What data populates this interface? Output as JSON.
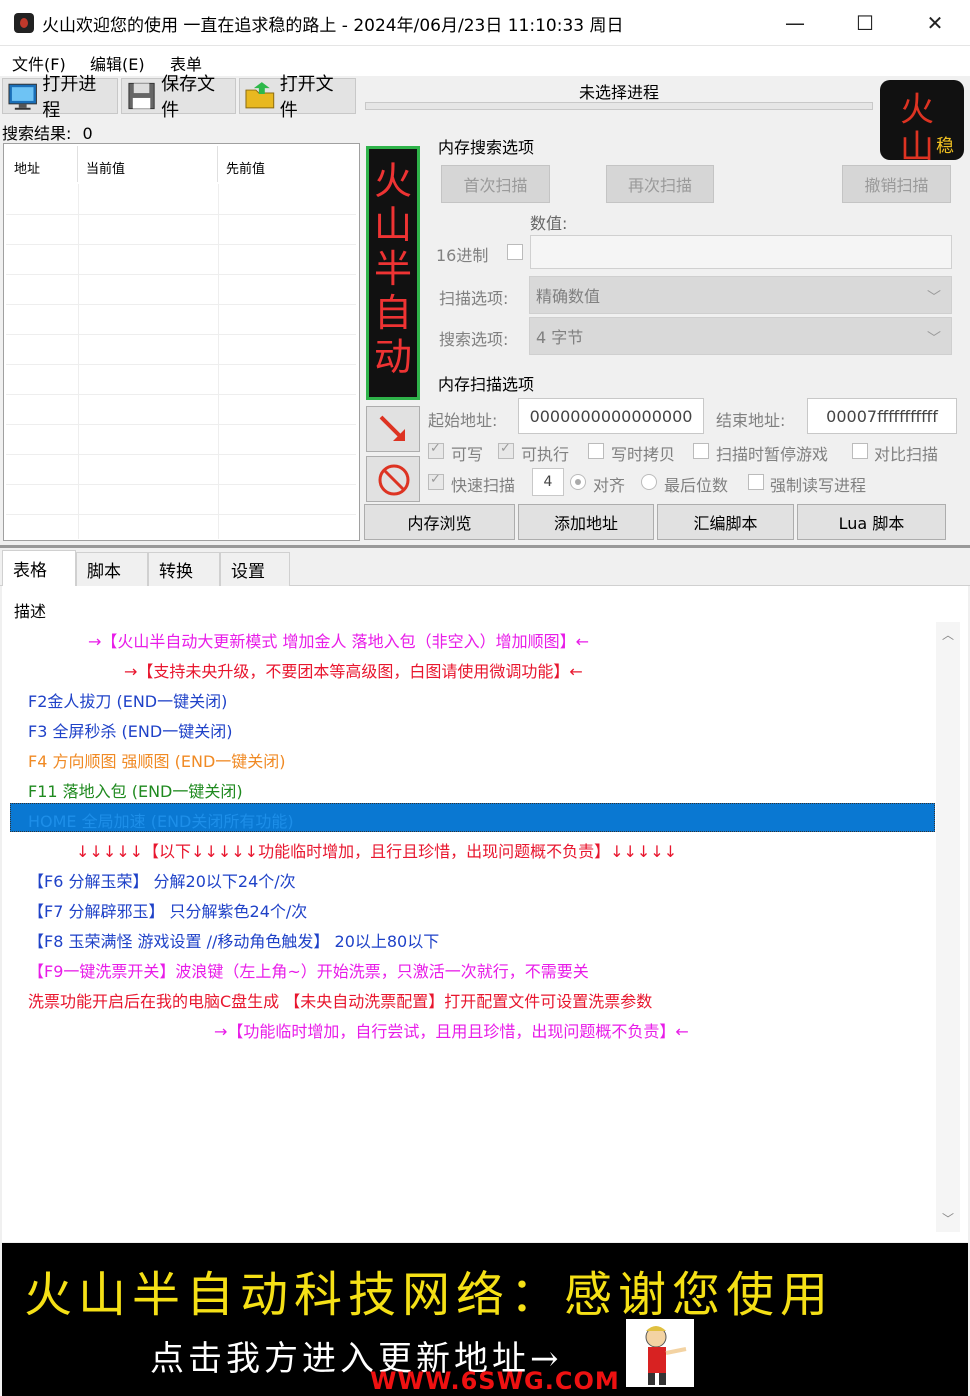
{
  "window": {
    "title": "火山欢迎您的使用 一直在追求稳的路上  - 2024年/06月/23日 11:10:33 周日",
    "minimize": "—",
    "maximize": "☐",
    "close": "✕"
  },
  "menu": [
    "文件(F)",
    "编辑(E)",
    "表单"
  ],
  "toolbar": {
    "open_process": "打开进程",
    "save_file": "保存文件",
    "open_file": "打开文件"
  },
  "process": {
    "label": "未选择进程"
  },
  "logo": {
    "char1": "火",
    "char2": "山",
    "char3": "稳"
  },
  "search": {
    "result_label": "搜索结果:",
    "result_count": "0"
  },
  "list_columns": [
    "地址",
    "当前值",
    "先前值"
  ],
  "vertical_banner": "火山半自动",
  "memory_search": {
    "title": "内存搜索选项",
    "first_scan": "首次扫描",
    "next_scan": "再次扫描",
    "undo_scan": "撤销扫描",
    "value_label": "数值:",
    "hex_label": "16进制",
    "scan_type_label": "扫描选项:",
    "scan_type_value": "精确数值",
    "value_type_label": "搜索选项:",
    "value_type_value": "4 字节"
  },
  "memory_scan": {
    "title": "内存扫描选项",
    "start_label": "起始地址:",
    "start_value": "0000000000000000",
    "end_label": "结束地址:",
    "end_value": "00007fffffffffff",
    "writable": "可写",
    "executable": "可执行",
    "copy_on_write": "写时拷贝",
    "pause_game": "扫描时暂停游戏",
    "compare_scan": "对比扫描",
    "fast_scan": "快速扫描",
    "fast_scan_value": "4",
    "aligned": "对齐",
    "last_digits": "最后位数",
    "force_rw": "强制读写进程"
  },
  "bottom_buttons": {
    "memory_view": "内存浏览",
    "add_address": "添加地址",
    "assemble": "汇编脚本",
    "lua": "Lua 脚本"
  },
  "tabs": [
    "表格",
    "脚本",
    "转换",
    "设置"
  ],
  "table": {
    "desc_header": "描述"
  },
  "cheat_lines": [
    {
      "text": "→【火山半自动大更新模式 增加金人 落地入包（非空入）增加顺图】←",
      "color": "#e81ce8"
    },
    {
      "text": "→【支持未央升级，不要团本等高级图，白图请使用微调功能】←",
      "color": "#e8162e"
    },
    {
      "text": "F2金人拔刀   (END一键关闭)",
      "color": "#1f42c8"
    },
    {
      "text": "F3 全屏秒杀   (END一键关闭)",
      "color": "#1f42c8"
    },
    {
      "text": "F4 方向顺图  强顺图 (END一键关闭)",
      "color": "#f08a24"
    },
    {
      "text": "F11 落地入包   (END一键关闭)",
      "color": "#1f8a1f"
    },
    {
      "text": "HOME 全局加速   (END关闭所有功能)",
      "color": "#1d8ee8"
    },
    {
      "text": "↓↓↓↓↓【以下↓↓↓↓↓功能临时增加，且行且珍惜，出现问题概不负责】↓↓↓↓↓",
      "color": "#e8162e"
    },
    {
      "text": "【F6 分解玉荣】               分解20以下24个/次",
      "color": "#1f42c8"
    },
    {
      "text": "【F7 分解辟邪玉】             只分解紫色24个/次",
      "color": "#1f42c8"
    },
    {
      "text": "【F8 玉荣满怪 游戏设置 //移动角色触发】                20以上80以下",
      "color": "#1f42c8"
    },
    {
      "text": "【F9一键洗票开关】波浪键（左上角~）开始洗票，只激活一次就行，不需要关",
      "color": "#e81ce8"
    },
    {
      "text": "洗票功能开启后在我的电脑C盘生成 【未央自动洗票配置】打开配置文件可设置洗票参数",
      "color": "#e8162e"
    },
    {
      "text": "→【功能临时增加，自行尝试，且用且珍惜，出现问题概不负责】←",
      "color": "#e81ce8"
    }
  ],
  "footer": {
    "title": "火山半自动科技网络：感谢您使用",
    "subtitle": "点击我方进入更新地址→",
    "url": "WWW.6SWG.COM"
  }
}
